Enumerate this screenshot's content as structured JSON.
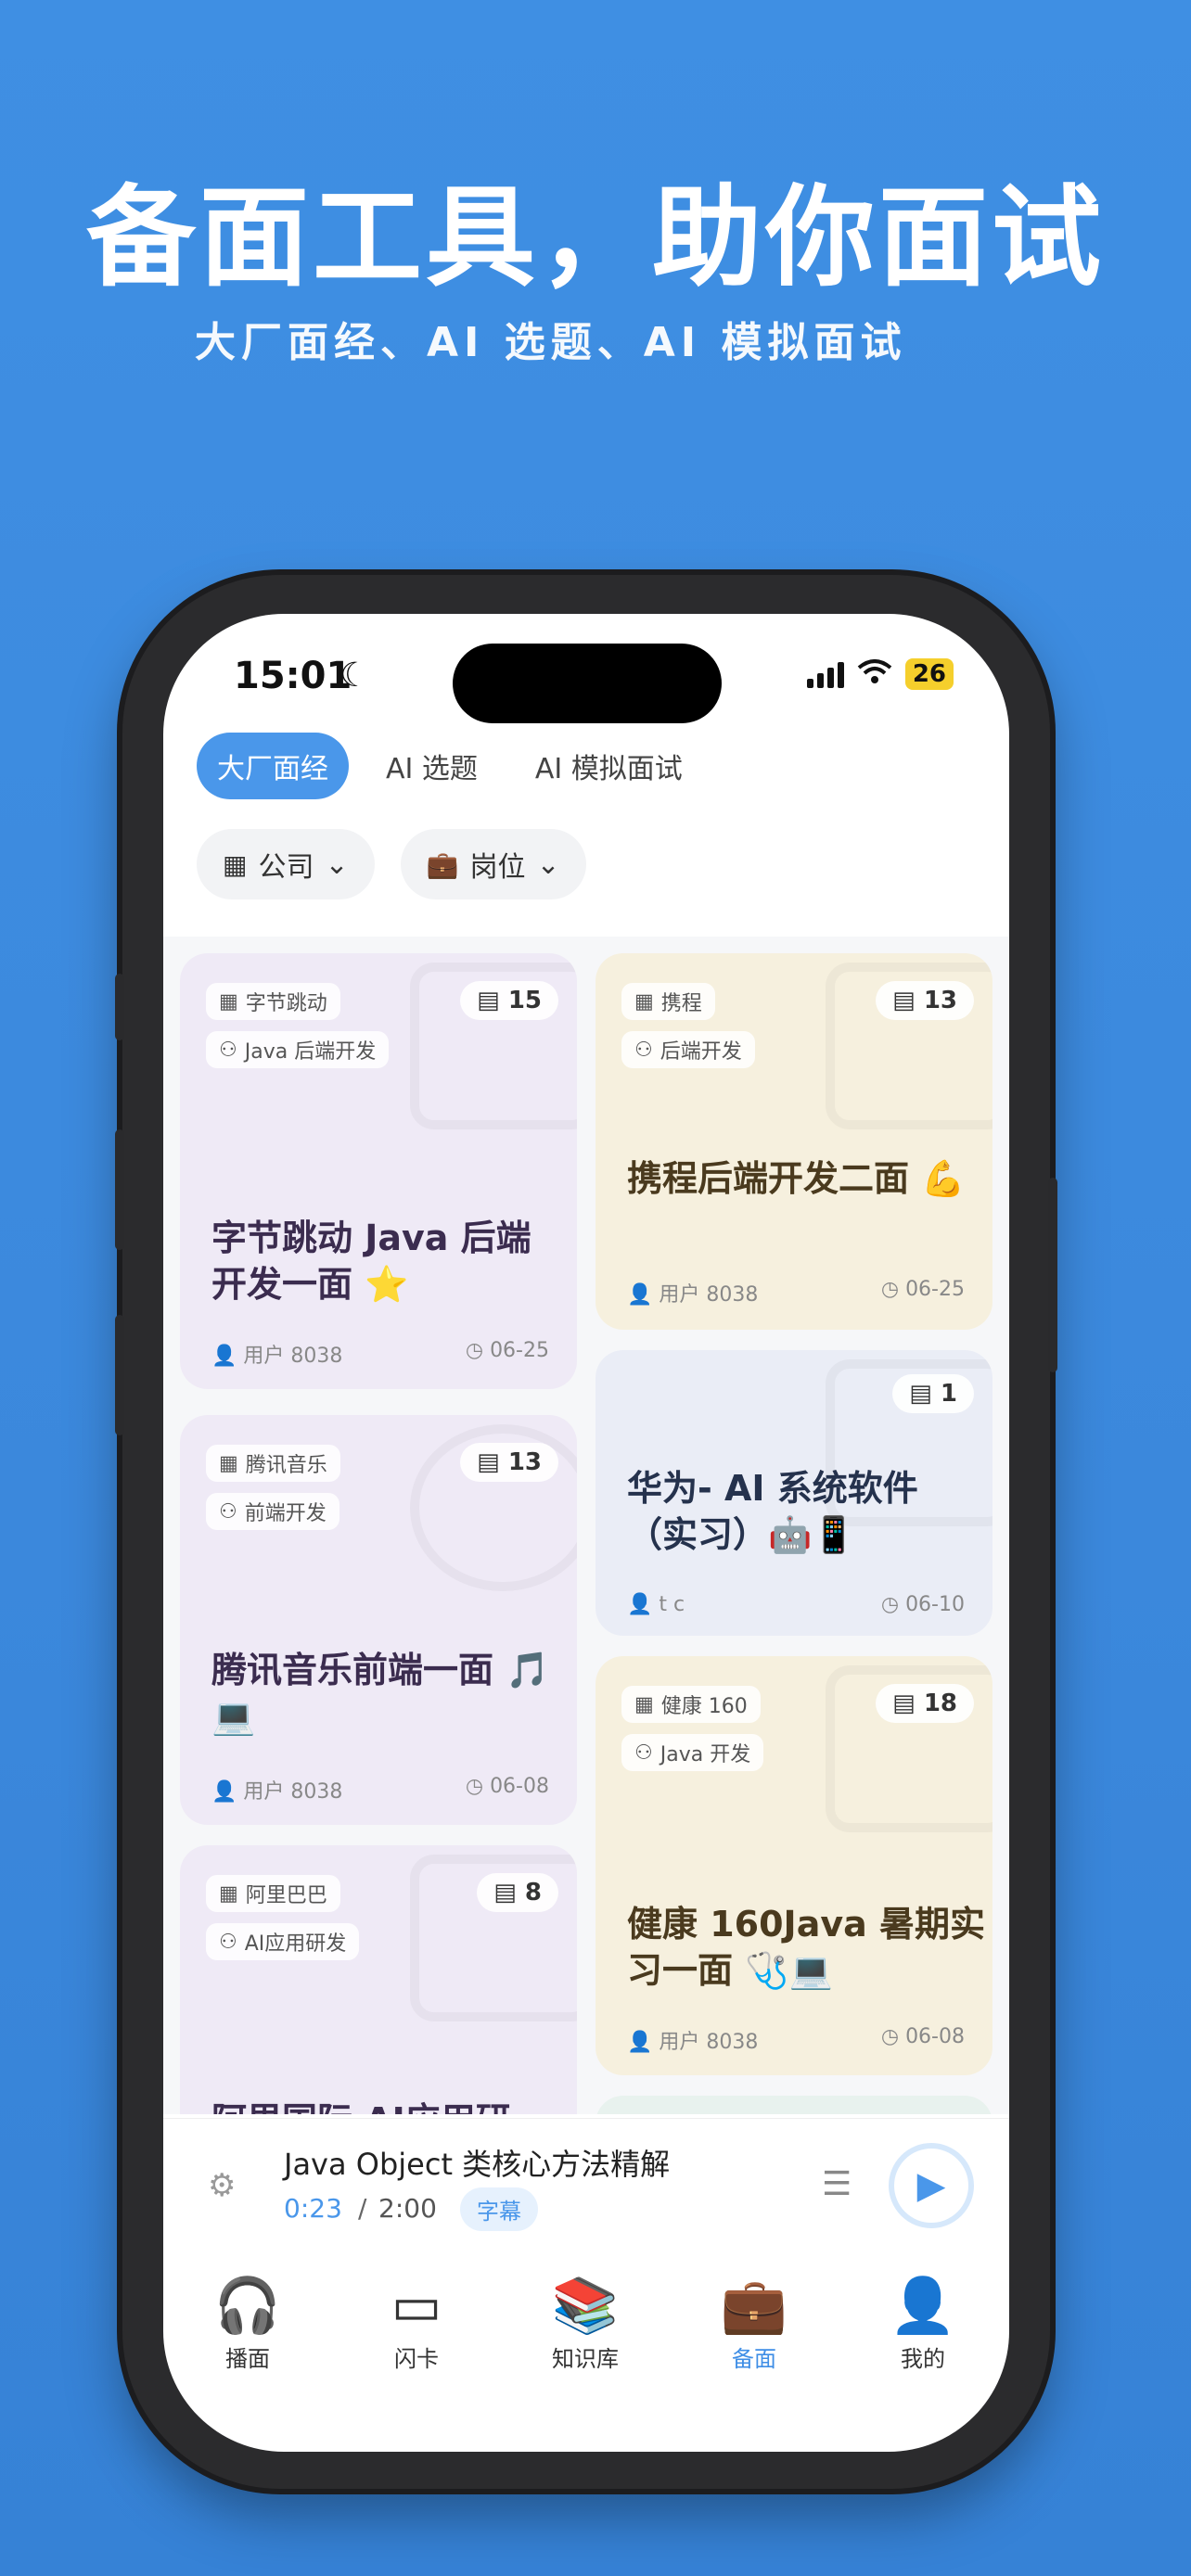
{
  "hero": {
    "title": "备面工具，助你面试",
    "subtitle": "大厂面经、AI 选题、AI 模拟面试"
  },
  "status_bar": {
    "time": "15:01",
    "battery": "26"
  },
  "tabs": [
    {
      "label": "大厂面经",
      "active": true
    },
    {
      "label": "AI 选题",
      "active": false
    },
    {
      "label": "AI 模拟面试",
      "active": false
    }
  ],
  "filters": [
    {
      "label": "公司",
      "icon": "building-icon"
    },
    {
      "label": "岗位",
      "icon": "briefcase-icon"
    }
  ],
  "cards": [
    {
      "company": "字节跳动",
      "role": "Java 后端开发",
      "count": "15",
      "title": "字节跳动 Java 后端开发一面 ⭐",
      "user": "用户 8038",
      "date": "06-25",
      "bg": "#efeaf6",
      "title_color": "#3b2c4f"
    },
    {
      "company": "携程",
      "role": "后端开发",
      "count": "13",
      "title": "携程后端开发二面 💪",
      "user": "用户 8038",
      "date": "06-25",
      "bg": "#f6f0de",
      "title_color": "#4a3a1e"
    },
    {
      "company": "腾讯音乐",
      "role": "前端开发",
      "count": "13",
      "title": "腾讯音乐前端一面 🎵💻",
      "user": "用户 8038",
      "date": "06-08",
      "bg": "#efeaf6",
      "title_color": "#3b2c4f"
    },
    {
      "company": "",
      "role": "",
      "count": "1",
      "title": "华为- AI 系统软件（实习）🤖📱",
      "user": "t c",
      "date": "06-10",
      "bg": "#eaedf6",
      "title_color": "#25324d"
    },
    {
      "company": "阿里巴巴",
      "role": "AI应用研发",
      "count": "8",
      "title": "阿里国际 AI应用研",
      "user": "",
      "date": "",
      "bg": "#efeaf6",
      "title_color": "#3b2c4f"
    },
    {
      "company": "健康 160",
      "role": "Java 开发",
      "count": "18",
      "title": "健康 160Java 暑期实习一面 🩺💻",
      "user": "用户 8038",
      "date": "06-08",
      "bg": "#f6f0de",
      "title_color": "#4a3a1e"
    }
  ],
  "player": {
    "title": "Java Object 类核心方法精解",
    "current": "0:23",
    "separator": "/",
    "total": "2:00",
    "subtitle_badge": "字幕"
  },
  "nav": [
    {
      "label": "播面",
      "icon": "headphones-icon",
      "active": false
    },
    {
      "label": "闪卡",
      "icon": "cards-icon",
      "active": false
    },
    {
      "label": "知识库",
      "icon": "books-icon",
      "active": false
    },
    {
      "label": "备面",
      "icon": "briefcase-icon",
      "active": true
    },
    {
      "label": "我的",
      "icon": "person-icon",
      "active": false
    }
  ],
  "colors": {
    "accent": "#4a97ea",
    "background": "#3f8fe3"
  }
}
